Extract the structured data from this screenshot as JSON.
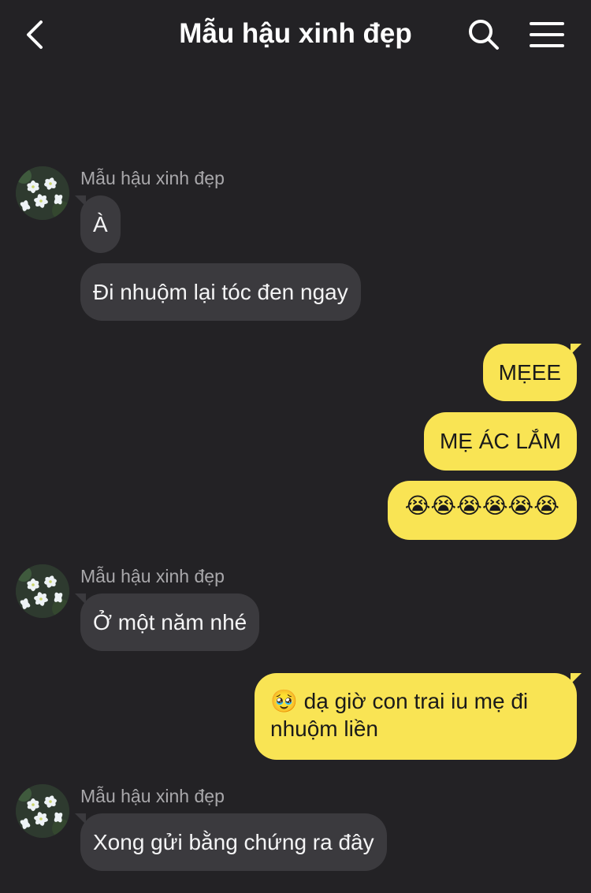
{
  "header": {
    "title": "Mẫu hậu xinh đẹp",
    "back_icon": "chevron-left-icon",
    "search_icon": "search-icon",
    "menu_icon": "hamburger-menu-icon"
  },
  "contact_name": "Mẫu hậu xinh đẹp",
  "messages": [
    {
      "from": "contact",
      "text": "À"
    },
    {
      "from": "contact",
      "text": "Đi nhuộm lại tóc đen ngay"
    },
    {
      "from": "me",
      "text": "MẸEE"
    },
    {
      "from": "me",
      "text": "MẸ ÁC LẮM"
    },
    {
      "from": "me",
      "text": "😭😭😭😭😭😭"
    },
    {
      "from": "contact",
      "text": "Ở một năm nhé"
    },
    {
      "from": "me",
      "text": "🥹 dạ giờ con trai iu mẹ đi nhuộm liền"
    },
    {
      "from": "contact",
      "text": "Xong gửi bằng chứng ra đây"
    }
  ],
  "colors": {
    "background": "#232225",
    "incoming_bubble": "#3b3a3e",
    "outgoing_bubble": "#f9e454",
    "sender_name": "#a9a8ab"
  }
}
